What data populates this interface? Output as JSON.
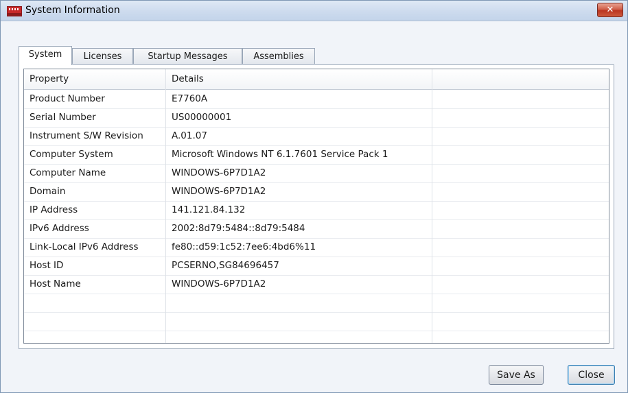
{
  "window": {
    "title": "System Information",
    "close_glyph": "✕"
  },
  "tabs": [
    {
      "label": "System",
      "active": true
    },
    {
      "label": "Licenses",
      "active": false
    },
    {
      "label": "Startup Messages",
      "active": false
    },
    {
      "label": "Assemblies",
      "active": false
    }
  ],
  "table": {
    "columns": [
      "Property",
      "Details",
      ""
    ],
    "rows": [
      {
        "property": "Product Number",
        "details": "E7760A"
      },
      {
        "property": "Serial Number",
        "details": "US00000001"
      },
      {
        "property": "Instrument S/W Revision",
        "details": "A.01.07"
      },
      {
        "property": "Computer System",
        "details": "Microsoft Windows NT 6.1.7601 Service Pack 1"
      },
      {
        "property": "Computer Name",
        "details": "WINDOWS-6P7D1A2"
      },
      {
        "property": "Domain",
        "details": "WINDOWS-6P7D1A2"
      },
      {
        "property": "IP Address",
        "details": "141.121.84.132"
      },
      {
        "property": "IPv6 Address",
        "details": "2002:8d79:5484::8d79:5484"
      },
      {
        "property": "Link-Local IPv6 Address",
        "details": "fe80::d59:1c52:7ee6:4bd6%11"
      },
      {
        "property": "Host ID",
        "details": "PCSERNO,SG84696457"
      },
      {
        "property": "Host Name",
        "details": "WINDOWS-6P7D1A2"
      }
    ]
  },
  "buttons": {
    "save_as": "Save As",
    "close": "Close"
  },
  "colors": {
    "title_bar": "#cddbee",
    "close_button": "#c9452f",
    "window_bg": "#f1f4f9"
  }
}
